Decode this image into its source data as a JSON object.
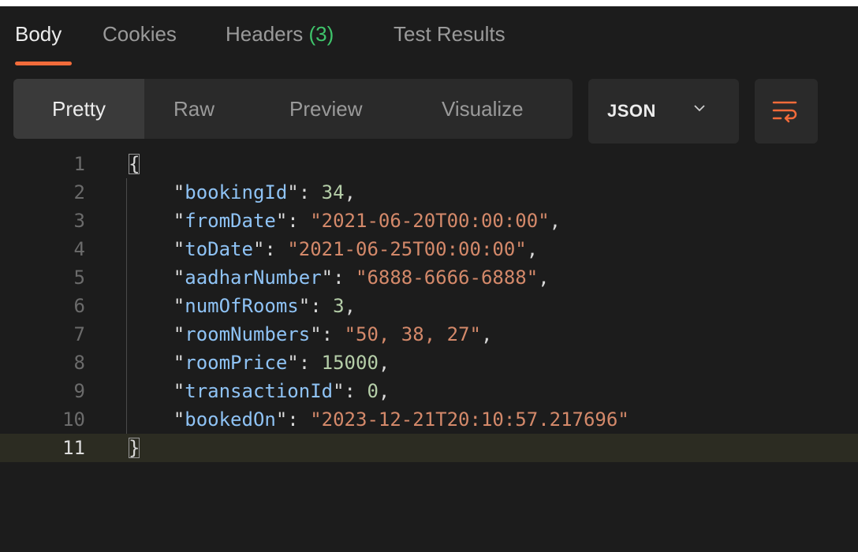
{
  "tabs": [
    {
      "label": "Body",
      "active": true
    },
    {
      "label": "Cookies",
      "active": false
    },
    {
      "label": "Headers",
      "count": "(3)",
      "active": false
    },
    {
      "label": "Test Results",
      "active": false
    }
  ],
  "view_modes": [
    "Pretty",
    "Raw",
    "Preview",
    "Visualize"
  ],
  "active_view": "Pretty",
  "format": {
    "selected": "JSON",
    "icon": "chevron-down-icon"
  },
  "wrap_button": {
    "icon": "wrap-lines-icon"
  },
  "colors": {
    "accent": "#f26b3a",
    "count": "#3fc46b",
    "key": "#8fc3f5",
    "string": "#d4896a",
    "number": "#b5cea8"
  },
  "editor": {
    "current_line": 11,
    "lines": [
      {
        "n": "1",
        "open": "{"
      },
      {
        "n": "2",
        "key": "bookingId",
        "value": "34",
        "type": "number",
        "comma": ","
      },
      {
        "n": "3",
        "key": "fromDate",
        "value": "\"2021-06-20T00:00:00\"",
        "type": "string",
        "comma": ","
      },
      {
        "n": "4",
        "key": "toDate",
        "value": "\"2021-06-25T00:00:00\"",
        "type": "string",
        "comma": ","
      },
      {
        "n": "5",
        "key": "aadharNumber",
        "value": "\"6888-6666-6888\"",
        "type": "string",
        "comma": ","
      },
      {
        "n": "6",
        "key": "numOfRooms",
        "value": "3",
        "type": "number",
        "comma": ","
      },
      {
        "n": "7",
        "key": "roomNumbers",
        "value": "\"50, 38, 27\"",
        "type": "string",
        "comma": ","
      },
      {
        "n": "8",
        "key": "roomPrice",
        "value": "15000",
        "type": "number",
        "comma": ","
      },
      {
        "n": "9",
        "key": "transactionId",
        "value": "0",
        "type": "number",
        "comma": ","
      },
      {
        "n": "10",
        "key": "bookedOn",
        "value": "\"2023-12-21T20:10:57.217696\"",
        "type": "string",
        "comma": ""
      },
      {
        "n": "11",
        "close": "}"
      }
    ]
  }
}
